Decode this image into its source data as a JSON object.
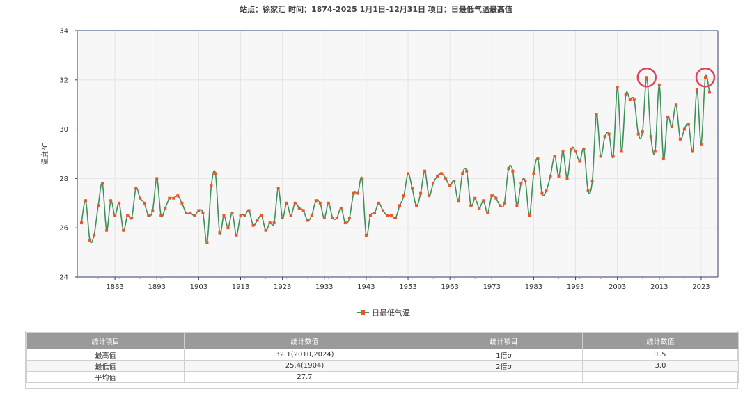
{
  "title": "站点：徐家汇 时间：1874-2025  1月1日-12月31日 项目：日最低气温最高值",
  "chart_data": {
    "type": "line",
    "title": "站点：徐家汇 时间：1874-2025  1月1日-12月31日 项目：日最低气温最高值",
    "ylabel": "温度°C",
    "xlabel": "",
    "ylim": [
      24,
      34
    ],
    "yticks": [
      24,
      26,
      28,
      30,
      32,
      34
    ],
    "xlim": [
      1874,
      2027
    ],
    "xticks": [
      1883,
      1893,
      1903,
      1913,
      1923,
      1933,
      1943,
      1953,
      1963,
      1973,
      1983,
      1993,
      2003,
      2013,
      2023
    ],
    "grid": true,
    "legend": "bottom-center",
    "series": [
      {
        "name": "日最低气温",
        "color_line": "#3f8f5a",
        "color_marker": "#e8572a",
        "x": [
          1875,
          1876,
          1877,
          1878,
          1879,
          1880,
          1881,
          1882,
          1883,
          1884,
          1885,
          1886,
          1887,
          1888,
          1889,
          1890,
          1891,
          1892,
          1893,
          1894,
          1895,
          1896,
          1897,
          1898,
          1899,
          1900,
          1901,
          1902,
          1903,
          1904,
          1905,
          1906,
          1907,
          1908,
          1909,
          1910,
          1911,
          1912,
          1913,
          1914,
          1915,
          1916,
          1917,
          1918,
          1919,
          1920,
          1921,
          1922,
          1923,
          1924,
          1925,
          1926,
          1927,
          1928,
          1929,
          1930,
          1931,
          1932,
          1933,
          1934,
          1935,
          1936,
          1937,
          1938,
          1939,
          1940,
          1941,
          1942,
          1943,
          1944,
          1945,
          1946,
          1947,
          1948,
          1949,
          1950,
          1951,
          1952,
          1953,
          1954,
          1955,
          1956,
          1957,
          1958,
          1959,
          1960,
          1961,
          1962,
          1963,
          1964,
          1965,
          1966,
          1967,
          1968,
          1969,
          1970,
          1971,
          1972,
          1973,
          1974,
          1975,
          1976,
          1977,
          1978,
          1979,
          1980,
          1981,
          1982,
          1983,
          1984,
          1985,
          1986,
          1987,
          1988,
          1989,
          1990,
          1991,
          1992,
          1993,
          1994,
          1995,
          1996,
          1997,
          1998,
          1999,
          2000,
          2001,
          2002,
          2003,
          2004,
          2005,
          2006,
          2007,
          2008,
          2009,
          2010,
          2011,
          2012,
          2013,
          2014,
          2015,
          2016,
          2017,
          2018,
          2019,
          2020,
          2021,
          2022,
          2023,
          2024,
          2025
        ],
        "values": [
          26.2,
          27.1,
          25.5,
          25.7,
          26.9,
          27.8,
          25.9,
          27.1,
          26.5,
          27.0,
          25.9,
          26.5,
          26.4,
          27.6,
          27.2,
          27.0,
          26.5,
          26.7,
          28.0,
          26.5,
          26.8,
          27.2,
          27.2,
          27.3,
          27.0,
          26.6,
          26.6,
          26.5,
          26.7,
          26.6,
          25.4,
          27.7,
          28.2,
          25.8,
          26.5,
          26.0,
          26.6,
          25.7,
          26.5,
          26.5,
          26.7,
          26.1,
          26.3,
          26.5,
          25.9,
          26.2,
          26.2,
          27.6,
          26.4,
          27.0,
          26.5,
          27.0,
          26.8,
          26.7,
          26.3,
          26.5,
          27.1,
          27.0,
          26.4,
          27.0,
          26.4,
          26.4,
          26.8,
          26.2,
          26.4,
          27.4,
          27.4,
          28.0,
          25.7,
          26.5,
          26.6,
          27.0,
          26.7,
          26.5,
          26.5,
          26.4,
          26.9,
          27.3,
          28.2,
          27.6,
          26.9,
          27.4,
          28.3,
          27.3,
          27.8,
          28.1,
          28.2,
          28.0,
          27.7,
          27.9,
          27.1,
          28.2,
          28.3,
          26.9,
          27.2,
          26.8,
          27.1,
          26.6,
          27.3,
          27.2,
          26.9,
          27.0,
          28.4,
          28.3,
          26.9,
          27.8,
          27.9,
          26.5,
          28.2,
          28.8,
          27.4,
          27.5,
          28.1,
          28.9,
          28.1,
          29.1,
          28.0,
          29.2,
          29.1,
          28.7,
          29.2,
          27.5,
          27.9,
          30.6,
          28.9,
          29.7,
          29.8,
          28.9,
          31.7,
          29.1,
          31.4,
          31.2,
          31.2,
          29.8,
          29.9,
          32.1,
          29.7,
          29.1,
          31.8,
          28.8,
          30.5,
          30.1,
          31.0,
          29.6,
          30.0,
          30.2,
          29.1,
          31.6,
          29.4,
          32.1,
          31.5
        ]
      }
    ],
    "highlighted_points": [
      {
        "x": 2010,
        "y": 32.1
      },
      {
        "x": 2024,
        "y": 32.1
      }
    ]
  },
  "legend": {
    "label": "日最低气温"
  },
  "stats_table": {
    "headers": [
      "统计项目",
      "统计数值",
      "统计项目",
      "统计数值"
    ],
    "rows": [
      [
        "最高值",
        "32.1(2010,2024)",
        "1倍σ",
        "1.5"
      ],
      [
        "最低值",
        "25.4(1904)",
        "2倍σ",
        "3.0"
      ],
      [
        "平均值",
        "27.7",
        "",
        ""
      ]
    ]
  },
  "colors": {
    "line": "#3f8f5a",
    "marker": "#e8572a",
    "highlight": "#e0445a",
    "plot_bg": "#f7f7f7",
    "grid": "#e6e6e6",
    "axis": "#2e3f6e",
    "table_header": "#9a9a9a"
  }
}
